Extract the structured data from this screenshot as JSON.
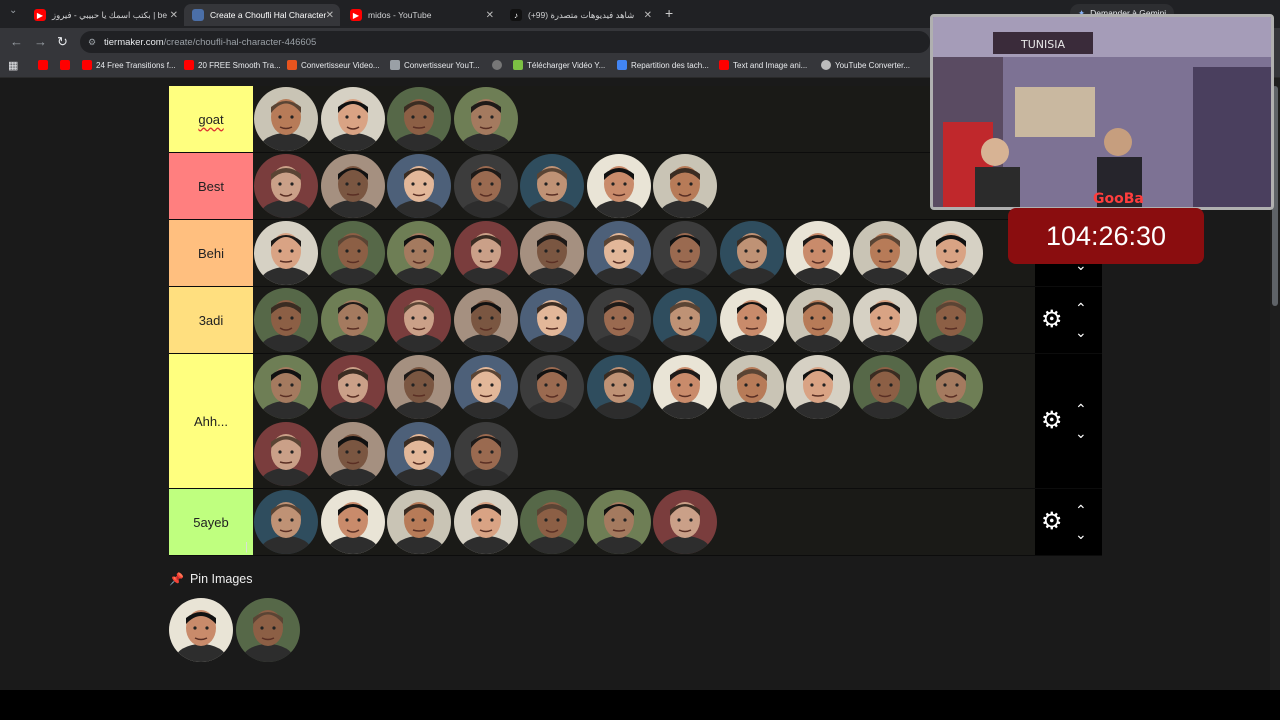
{
  "browser": {
    "tabs": [
      {
        "label": "بكتب اسمك يا حبيبي - فيروز | be",
        "icon": "youtube-icon",
        "active": false
      },
      {
        "label": "Create a Choufli Hal Character",
        "icon": "tiermaker-icon",
        "active": true
      },
      {
        "label": "midos - YouTube",
        "icon": "youtube-icon",
        "active": false
      },
      {
        "label": "شاهد فيديوهات متصدرة (99+)",
        "icon": "tiktok-icon",
        "active": false
      }
    ],
    "url_host": "tiermaker.com",
    "url_path": "/create/choufli-hal-character-446605",
    "gemini_button": "Demander à Gemini",
    "bookmarks": [
      {
        "label": "24 Free Transitions f...",
        "icon": "youtube-icon"
      },
      {
        "label": "20 FREE Smooth Tra...",
        "icon": "youtube-icon"
      },
      {
        "label": "Convertisseur Video...",
        "icon": "z-icon"
      },
      {
        "label": "Convertisseur YouT...",
        "icon": "converter-icon"
      },
      {
        "label": "Télécharger Vidéo Y...",
        "icon": "download-icon"
      },
      {
        "label": "Repartition des tach...",
        "icon": "docs-icon"
      },
      {
        "label": "Text and Image ani...",
        "icon": "youtube-icon"
      },
      {
        "label": "YouTube Converter...",
        "icon": "converter-icon"
      }
    ]
  },
  "tiers": [
    {
      "label": "goat",
      "color": "#ffff7f",
      "faces": 4
    },
    {
      "label": "Best",
      "color": "#ff7f7f",
      "faces": 7
    },
    {
      "label": "Behi",
      "color": "#ffbf7f",
      "faces": 11
    },
    {
      "label": "3adi",
      "color": "#ffdf7f",
      "faces": 11
    },
    {
      "label": "Ahh...",
      "color": "#ffff7f",
      "faces": 15
    },
    {
      "label": "5ayeb",
      "color": "#bfff7f",
      "faces": 7
    }
  ],
  "pin_images": {
    "heading": "Pin Images",
    "count": 2
  },
  "stream": {
    "timer": "104:26:30",
    "webcam_sign": "TUNISIA",
    "webcam_name": "GooBa"
  }
}
